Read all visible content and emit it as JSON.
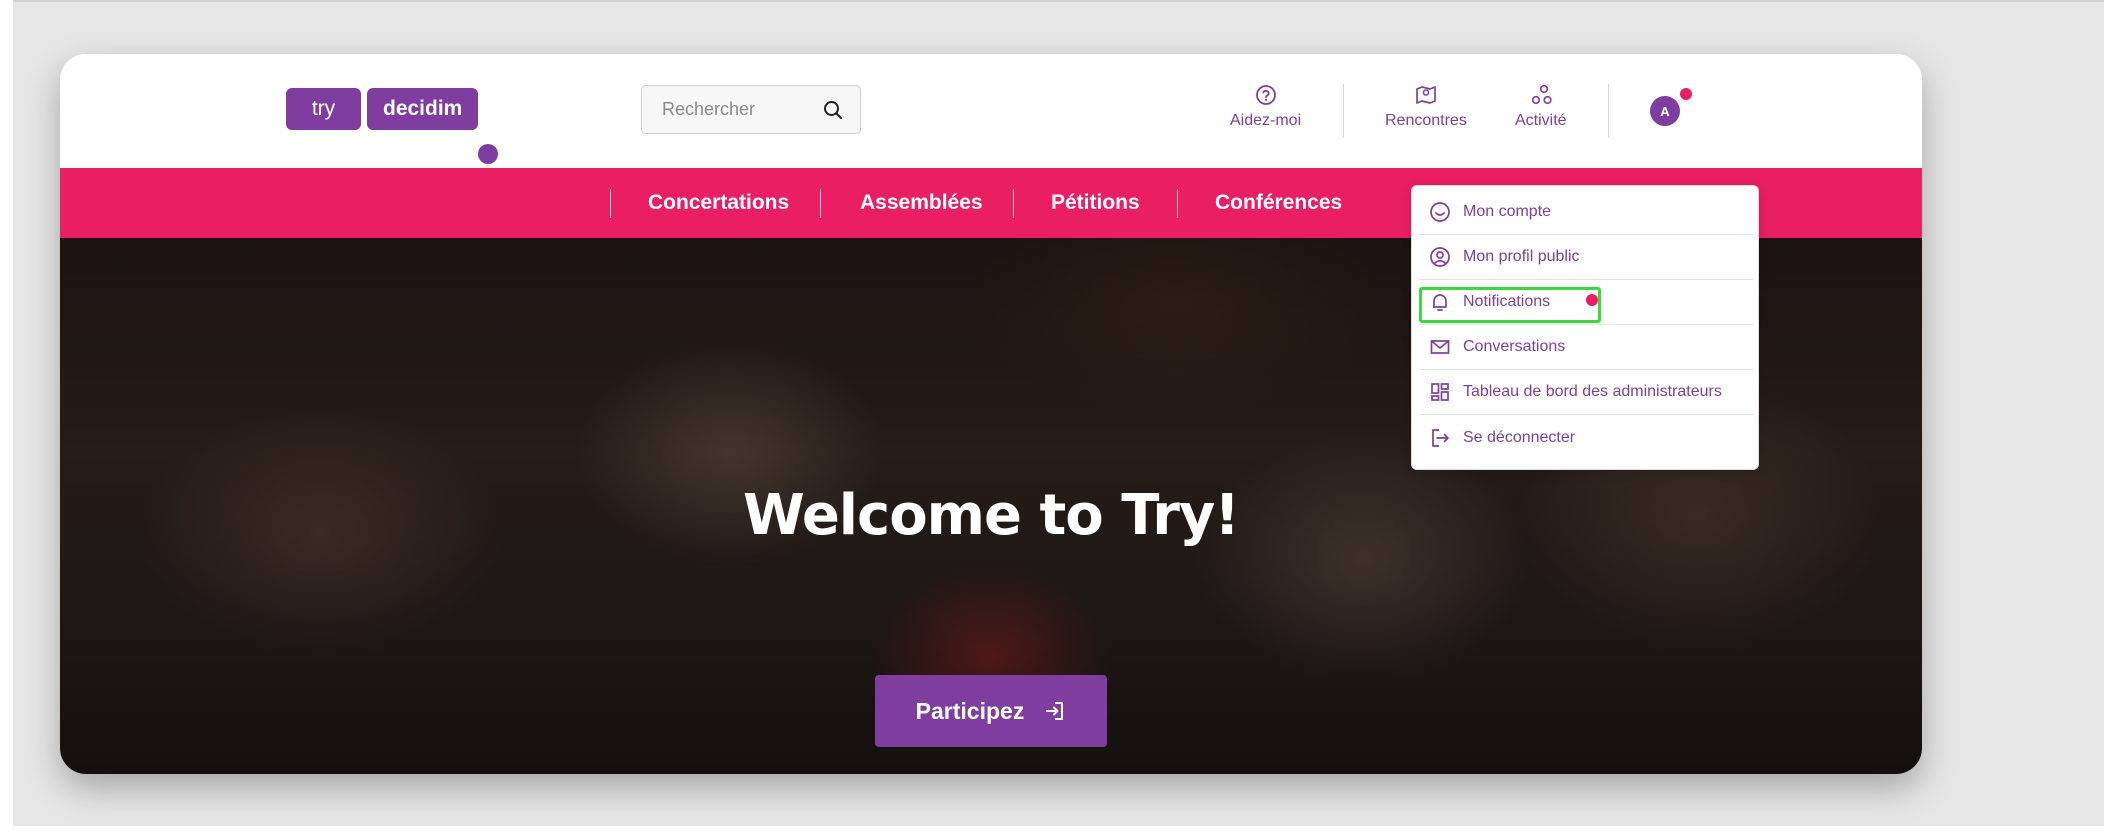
{
  "colors": {
    "brand_purple": "#7f3da0",
    "accent_pink": "#e91e63",
    "highlight_green": "#3cd83c"
  },
  "logo": {
    "part1": "try",
    "part2": "decidim"
  },
  "search": {
    "placeholder": "Rechercher",
    "icon": "search-icon"
  },
  "header_nav": [
    {
      "label": "Aidez-moi",
      "icon": "help-circle-icon"
    },
    {
      "label": "Rencontres",
      "icon": "map-pin-icon"
    },
    {
      "label": "Activité",
      "icon": "activity-icon"
    }
  ],
  "user": {
    "avatar_letter": "A",
    "has_notification": true
  },
  "main_nav": [
    "Concertations",
    "Assemblées",
    "Pétitions",
    "Conférences"
  ],
  "hero": {
    "title": "Welcome to Try!",
    "button_label": "Participez",
    "button_icon": "sign-in-icon"
  },
  "user_menu": [
    {
      "label": "Mon compte",
      "icon": "smile-icon"
    },
    {
      "label": "Mon profil public",
      "icon": "user-circle-icon"
    },
    {
      "label": "Notifications",
      "icon": "bell-icon",
      "unread": true,
      "highlighted": true
    },
    {
      "label": "Conversations",
      "icon": "mail-icon"
    },
    {
      "label": "Tableau de bord des administrateurs",
      "icon": "dashboard-icon"
    },
    {
      "label": "Se déconnecter",
      "icon": "logout-icon"
    }
  ]
}
